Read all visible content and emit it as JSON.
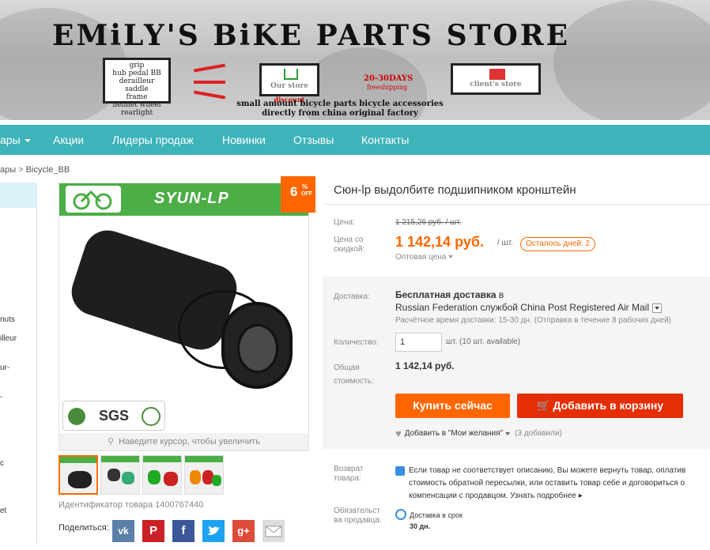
{
  "banner": {
    "title": "EMiLY'S BiKE PARTS STORE",
    "parts_words": [
      "grip",
      "hub pedal BB",
      "derailleur saddle",
      "frame",
      "helmet wheel",
      "rearlight"
    ],
    "our_store": "Our store",
    "discount": "discount",
    "ship_days": "20-30DAYS",
    "free_shipping": "freeshipping",
    "client_store": "client's store",
    "tagline_1": "small amount bicycle parts bicycle accessories",
    "tagline_2": "directly from china original factory"
  },
  "nav": {
    "items": [
      "ары",
      "Акции",
      "Лидеры продаж",
      "Новинки",
      "Отзывы",
      "Контакты"
    ]
  },
  "breadcrumb": {
    "first": "ары",
    "separator": ">",
    "current": "Bicycle_BB"
  },
  "sidebar": {
    "items": [
      "nuts",
      "illeur",
      "ur-",
      "-",
      "c",
      "et"
    ]
  },
  "product": {
    "brand": "SYUN-LP",
    "cert": "SGS",
    "zoom_hint": "Наведите курсор, чтобы увеличить",
    "discount_num": "6",
    "discount_pct": "%",
    "discount_off": "OFF",
    "id_text": "Идентификатор товара 1400767440",
    "share_label": "Поделиться:",
    "share_buttons": [
      "vk",
      "P",
      "f",
      "twitter",
      "g+",
      "mail"
    ],
    "title": "Сюн-lp выдолбите подшипником кронштейн"
  },
  "pricing": {
    "price_label": "Цена:",
    "old_price": "1 215,26 руб. / шт.",
    "discount_label_1": "Цена со",
    "discount_label_2": "скидкой:",
    "new_price": "1 142,14 руб.",
    "per_unit": "/ шт.",
    "days_left": "Осталось дней: 2",
    "wholesale": "Оптовая цена"
  },
  "shipping": {
    "label": "Доставка:",
    "free_prefix": "Бесплатная доставка",
    "free_suffix": "в",
    "line": "Russian Federation службой China Post Registered Air Mail",
    "estimate": "Расчётное время доставки: 15-30 дн. (Отправка в течение 8 рабочих дней)"
  },
  "quantity": {
    "label": "Количество:",
    "value": "1",
    "note": "шт. (10 шт. available)"
  },
  "total": {
    "label_1": "Общая",
    "label_2": "стоимость:",
    "value": "1 142,14 руб."
  },
  "buttons": {
    "buy_now": "Купить сейчас",
    "add_to_cart": "Добавить в корзину",
    "wishlist": "Добавить в \"Мои желания\"",
    "wishlist_count": "(3 добавили)"
  },
  "return_policy": {
    "label_1": "Возврат",
    "label_2": "товара:",
    "line_1": "Если товар не соответствует описанию, Вы можете вернуть товар, оплатив",
    "line_2": "стоимость обратной пересылки, или оставить товар себе и договориться о",
    "line_3": "компенсации с продавцом.",
    "more": "Узнать подробнее"
  },
  "guarantee": {
    "label_1": "Обязательст",
    "label_2": "ва продавца:",
    "line_1": "Доставка в срок",
    "line_2": "30 дн."
  },
  "colors": {
    "nav": "#3db3ba",
    "price": "#ff6600",
    "buy": "#ff6600",
    "cart": "#e62e04",
    "brand_green": "#4cae46"
  }
}
